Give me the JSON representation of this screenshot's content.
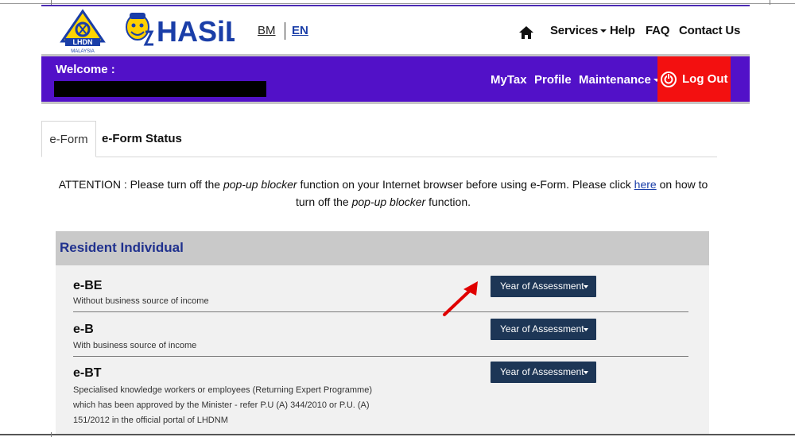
{
  "header": {
    "logo_primary_text": "LHDN",
    "logo_primary_sub": "MALAYSIA",
    "logo_secondary_text": "HASiL",
    "lang_bm": "BM",
    "lang_en": "EN",
    "nav": {
      "services": "Services",
      "help": "Help",
      "faq": "FAQ",
      "contact": "Contact Us"
    }
  },
  "welcome_bar": {
    "welcome_label": "Welcome :",
    "nav": {
      "mytax": "MyTax",
      "profile": "Profile",
      "maintenance": "Maintenance"
    },
    "logout": "Log Out",
    "colors": {
      "bar": "#5211c8",
      "logout": "#f31010"
    }
  },
  "tabs": {
    "eform": "e-Form",
    "eform_status": "e-Form Status"
  },
  "attention": {
    "prefix": "ATTENTION : Please turn off the ",
    "em1": "pop-up blocker",
    "mid": " function on your Internet browser before using e-Form. Please click ",
    "link": "here",
    "mid2": " on how to turn off the ",
    "em2": "pop-up blocker",
    "suffix": " function."
  },
  "panel": {
    "title": "Resident Individual",
    "rows": [
      {
        "title": "e-BE",
        "desc": "Without business source of income",
        "button": "Year of Assessment"
      },
      {
        "title": "e-B",
        "desc": "With business source of income",
        "button": "Year of Assessment"
      },
      {
        "title": "e-BT",
        "desc_lines": [
          "Specialised knowledge workers or employees (Returning Expert Programme)",
          "which has been approved by the Minister - refer P.U (A) 344/2010 or P.U. (A)",
          "151/2012 in the official portal of LHDNM"
        ],
        "button": "Year of Assessment"
      }
    ]
  },
  "annotation": {
    "arrow_color": "#e00000"
  }
}
